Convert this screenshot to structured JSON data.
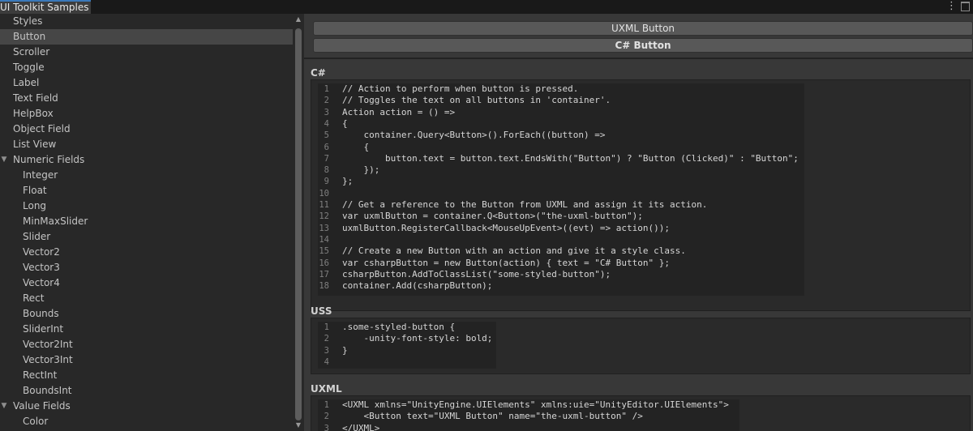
{
  "window": {
    "title": "UI Toolkit Samples"
  },
  "sidebar": {
    "items": [
      {
        "label": "Styles",
        "indent": 0,
        "foldout": "",
        "selected": false
      },
      {
        "label": "Button",
        "indent": 0,
        "foldout": "",
        "selected": true
      },
      {
        "label": "Scroller",
        "indent": 0,
        "foldout": "",
        "selected": false
      },
      {
        "label": "Toggle",
        "indent": 0,
        "foldout": "",
        "selected": false
      },
      {
        "label": "Label",
        "indent": 0,
        "foldout": "",
        "selected": false
      },
      {
        "label": "Text Field",
        "indent": 0,
        "foldout": "",
        "selected": false
      },
      {
        "label": "HelpBox",
        "indent": 0,
        "foldout": "",
        "selected": false
      },
      {
        "label": "Object Field",
        "indent": 0,
        "foldout": "",
        "selected": false
      },
      {
        "label": "List View",
        "indent": 0,
        "foldout": "",
        "selected": false
      },
      {
        "label": "Numeric Fields",
        "indent": 0,
        "foldout": "▼",
        "selected": false
      },
      {
        "label": "Integer",
        "indent": 1,
        "foldout": "",
        "selected": false
      },
      {
        "label": "Float",
        "indent": 1,
        "foldout": "",
        "selected": false
      },
      {
        "label": "Long",
        "indent": 1,
        "foldout": "",
        "selected": false
      },
      {
        "label": "MinMaxSlider",
        "indent": 1,
        "foldout": "",
        "selected": false
      },
      {
        "label": "Slider",
        "indent": 1,
        "foldout": "",
        "selected": false
      },
      {
        "label": "Vector2",
        "indent": 1,
        "foldout": "",
        "selected": false
      },
      {
        "label": "Vector3",
        "indent": 1,
        "foldout": "",
        "selected": false
      },
      {
        "label": "Vector4",
        "indent": 1,
        "foldout": "",
        "selected": false
      },
      {
        "label": "Rect",
        "indent": 1,
        "foldout": "",
        "selected": false
      },
      {
        "label": "Bounds",
        "indent": 1,
        "foldout": "",
        "selected": false
      },
      {
        "label": "SliderInt",
        "indent": 1,
        "foldout": "",
        "selected": false
      },
      {
        "label": "Vector2Int",
        "indent": 1,
        "foldout": "",
        "selected": false
      },
      {
        "label": "Vector3Int",
        "indent": 1,
        "foldout": "",
        "selected": false
      },
      {
        "label": "RectInt",
        "indent": 1,
        "foldout": "",
        "selected": false
      },
      {
        "label": "BoundsInt",
        "indent": 1,
        "foldout": "",
        "selected": false
      },
      {
        "label": "Value Fields",
        "indent": 0,
        "foldout": "▼",
        "selected": false
      },
      {
        "label": "Color",
        "indent": 1,
        "foldout": "",
        "selected": false
      }
    ]
  },
  "buttons": {
    "uxml": "UXML Button",
    "csharp": "C# Button"
  },
  "sections": [
    {
      "label": "C#",
      "lines": [
        "// Action to perform when button is pressed.",
        "// Toggles the text on all buttons in 'container'.",
        "Action action = () =>",
        "{",
        "    container.Query<Button>().ForEach((button) =>",
        "    {",
        "        button.text = button.text.EndsWith(\"Button\") ? \"Button (Clicked)\" : \"Button\";",
        "    });",
        "};",
        "",
        "// Get a reference to the Button from UXML and assign it its action.",
        "var uxmlButton = container.Q<Button>(\"the-uxml-button\");",
        "uxmlButton.RegisterCallback<MouseUpEvent>((evt) => action());",
        "",
        "// Create a new Button with an action and give it a style class.",
        "var csharpButton = new Button(action) { text = \"C# Button\" };",
        "csharpButton.AddToClassList(\"some-styled-button\");",
        "container.Add(csharpButton);"
      ]
    },
    {
      "label": "USS",
      "lines": [
        ".some-styled-button {",
        "    -unity-font-style: bold;",
        "}",
        ""
      ]
    },
    {
      "label": "UXML",
      "lines": [
        "<UXML xmlns=\"UnityEngine.UIElements\" xmlns:uie=\"UnityEditor.UIElements\">",
        "    <Button text=\"UXML Button\" name=\"the-uxml-button\" />",
        "</UXML>"
      ]
    }
  ],
  "colors": {
    "background": "#282828",
    "panel": "#383838",
    "selected_row": "#464646",
    "button": "#585858",
    "code_background": "#232323",
    "tab_accent": "#3a79bb"
  },
  "icons": {
    "menu": "kebab-menu-icon",
    "maximize": "maximize-icon",
    "foldout": "foldout-arrow-icon",
    "scroll_up": "scroll-up-arrow-icon",
    "scroll_down": "scroll-down-arrow-icon"
  }
}
